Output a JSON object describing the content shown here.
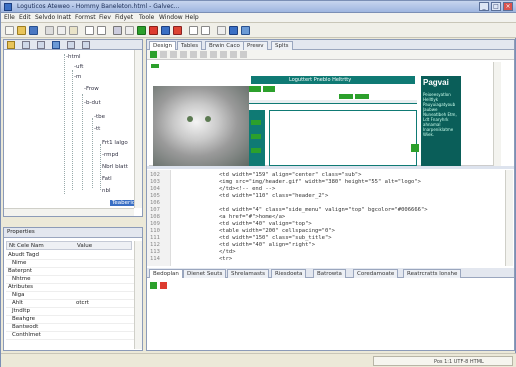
{
  "window": {
    "title": "Loguticos Ateweo - Hommy Baneleton.html - Galvec...",
    "min": "_",
    "max": "□",
    "close": "×"
  },
  "menu": [
    "Elle",
    "Edit",
    "Selvdo",
    "Inatt",
    "Formst",
    "Fiev",
    "Fidyet",
    "Toole",
    "Window",
    "Help"
  ],
  "side_tabs": {
    "top_icons": [
      "folder-icon",
      "tree-icon",
      "layers-icon",
      "grid-icon",
      "list-icon",
      "code-icon"
    ]
  },
  "tree": {
    "items": [
      "-html",
      "-uft",
      "-m",
      "-Frow",
      "-b-dut",
      "-tbe",
      "-tt",
      "Frt1 lalgo",
      "-rmpd",
      "Nbrl blatt",
      "Fatl",
      "nbl",
      "Teaberid"
    ]
  },
  "properties": {
    "title": "Properties",
    "col_name": "Nt Cele Nam",
    "col_value": "Value",
    "rows": [
      "Abudt Tagd",
      "Nime",
      "Baterpnt",
      "Nhtme",
      "Atributes",
      "Niga",
      "Ahlt",
      "Jtndltp",
      "Beahgre",
      "Bantwodt",
      "Conthlmet"
    ],
    "row_values": [
      "",
      "",
      "",
      "",
      "",
      "",
      "otcrt",
      "",
      "",
      "",
      ""
    ]
  },
  "editor_tabs": [
    "Design",
    "Tables",
    "Brwin Caco",
    "Prewv",
    "Splts"
  ],
  "editor_active_tab": 0,
  "preview": {
    "header_title": "Loguttert Pneblo Heltrtty",
    "ad_title": "Pagvai",
    "ad_text": "Peioeesyatlon Helltlyk Pauyuiagatyoub Jaubwe Nuneatlbeh Etm, Ldt Fnaryhrk ahnamal Inarpeniklatme Wiek."
  },
  "code": {
    "line_numbers": [
      "102",
      "103",
      "104",
      "105",
      "106",
      "107",
      "108",
      "109",
      "110",
      "111",
      "112",
      "113",
      "114"
    ],
    "lines": [
      "<td width=\"159\" align=\"center\" class=\"sub\">",
      "<img src=\"img/header.gif\" width=\"380\" height=\"55\" alt=\"logo\">",
      "</td><!-- end -->",
      "<td width=\"110\" class=\"header_2\">",
      "",
      "<td width=\"4\" class=\"side_menu\" valign=\"top\" bgcolor=\"#006666\">",
      "<a href=\"#\">home</a>",
      "<td width=\"40\" valign=\"top\">",
      "<table width=\"200\" cellspacing=\"0\">",
      "<td width=\"150\" class=\"sub_title\">",
      "<td width=\"40\" align=\"right\">",
      "</td>",
      "<tr>"
    ]
  },
  "bottom_tabs": [
    "Bedoplan",
    "Dienet Seuts",
    "Shrelamasts",
    "Riesdoeta",
    "Batrowta",
    "Coredamoate",
    "Reatrcratts lonshe"
  ],
  "status_text": "Pos 1:1   UTF-8   HTML",
  "colors": {
    "teal": "#0f7a74",
    "green": "#2ca02c",
    "teal_dark": "#0a5e59"
  }
}
